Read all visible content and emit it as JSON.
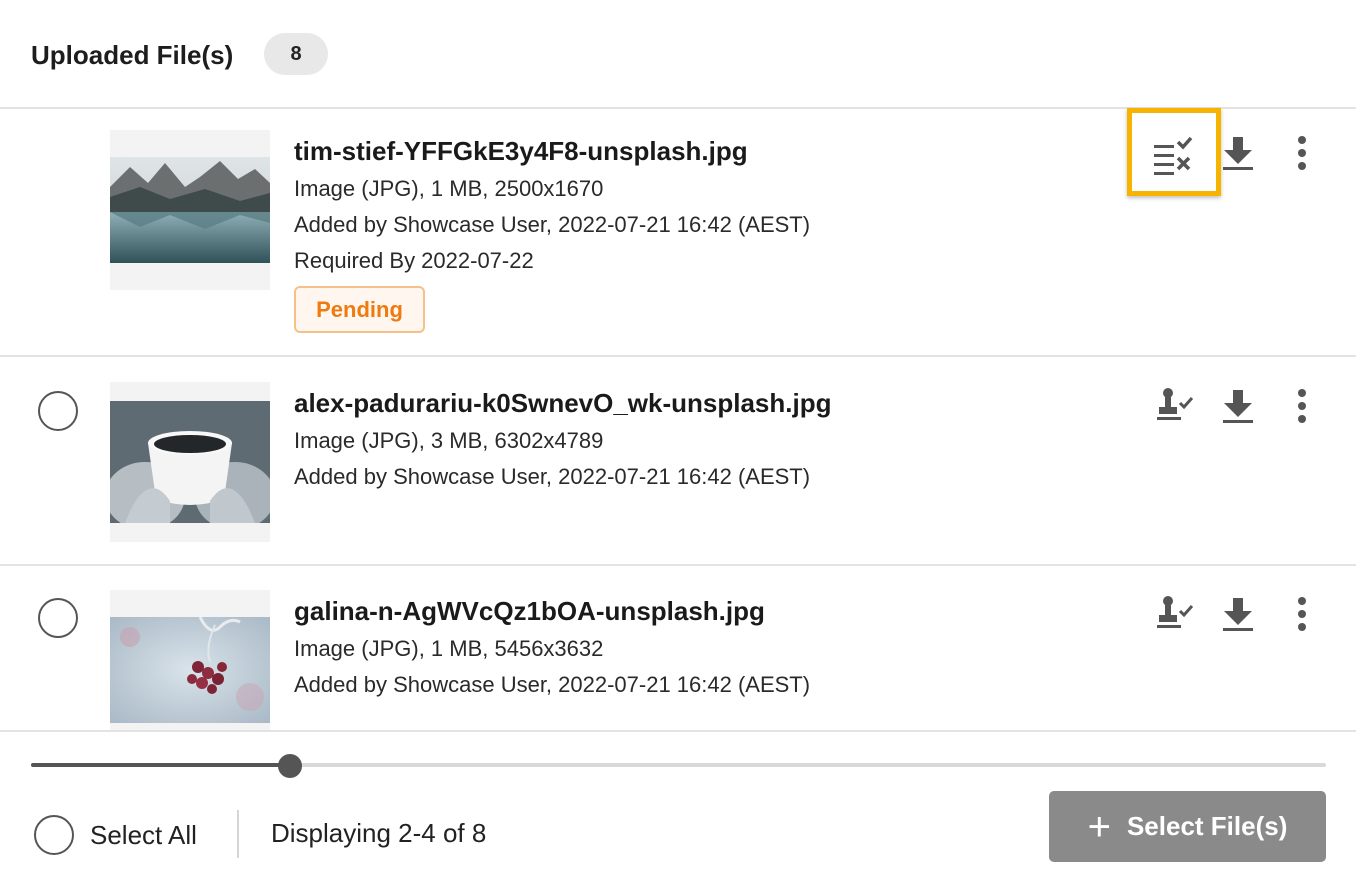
{
  "header": {
    "title": "Uploaded File(s)",
    "count": "8"
  },
  "files": [
    {
      "name": "tim-stief-YFFGkE3y4F8-unsplash.jpg",
      "info": "Image (JPG), 1 MB, 2500x1670",
      "added": "Added by Showcase User, 2022-07-21 16:42 (AEST)",
      "required": "Required By 2022-07-22",
      "status": "Pending",
      "status_color": "#ee7a10",
      "actions": [
        "approval-list-icon",
        "download-icon",
        "more-vertical-icon"
      ]
    },
    {
      "name": "alex-padurariu-k0SwnevO_wk-unsplash.jpg",
      "info": "Image (JPG), 3 MB, 6302x4789",
      "added": "Added by Showcase User, 2022-07-21 16:42 (AEST)",
      "actions": [
        "approve-stamp-icon",
        "download-icon",
        "more-vertical-icon"
      ]
    },
    {
      "name": "galina-n-AgWVcQz1bOA-unsplash.jpg",
      "info": "Image (JPG), 1 MB, 5456x3632",
      "added": "Added by Showcase User, 2022-07-21 16:42 (AEST)",
      "actions": [
        "approve-stamp-icon",
        "download-icon",
        "more-vertical-icon"
      ]
    }
  ],
  "scroll_position": 0.2,
  "footer": {
    "select_all_label": "Select All",
    "display_info": "Displaying 2-4 of 8",
    "select_files_label": "Select File(s)"
  },
  "colors": {
    "highlight": "#f6b400",
    "button_bg": "#8a8a8a",
    "pending": "#ee7a10"
  }
}
